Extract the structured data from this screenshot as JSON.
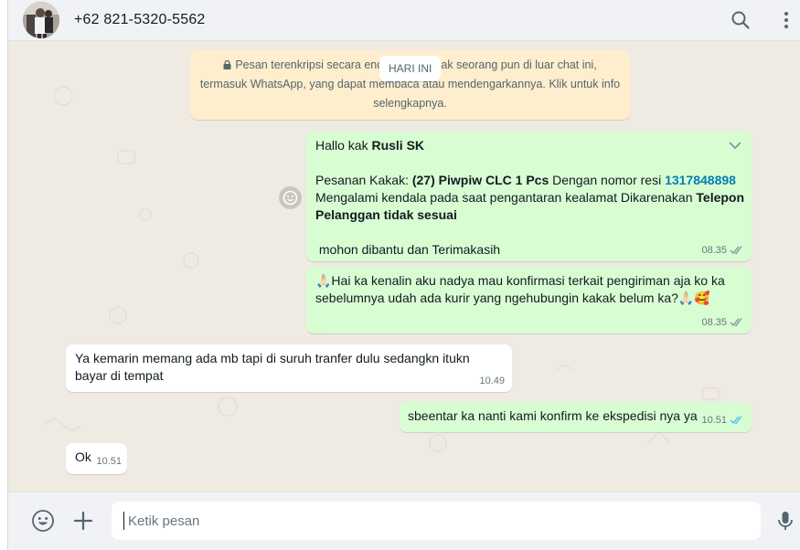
{
  "header": {
    "contact_name": "+62 821-5320-5562",
    "icons": [
      "search-icon",
      "menu-icon"
    ]
  },
  "encryption_notice": {
    "line1": "Pesan terenkripsi secara end-to-end. Tidak seorang pun di luar chat ini,",
    "line2": "termasuk WhatsApp, yang dapat membaca atau mendengarkannya. Klik untuk info",
    "line3": "selengkapnya."
  },
  "date_chip": "HARI INI",
  "messages": [
    {
      "direction": "out",
      "greeting": "Hallo kak ",
      "greeting_name": "Rusli SK",
      "order_prefix": "Pesanan Kakak: ",
      "order_item": "(27) Piwpiw CLC 1 Pcs",
      "order_mid": " Dengan nomor resi ",
      "resi": "1317848898",
      "issue_prefix": "Mengalami kendala pada saat pengantaran kealamat Dikarenakan ",
      "issue_reason": "Telepon Pelanggan tidak sesuai",
      "closing": " mohon dibantu dan Terimakasih",
      "time": "08.35",
      "status": "delivered"
    },
    {
      "direction": "out",
      "text": "🙏🏻Hai ka kenalin aku nadya mau konfirmasi terkait pengiriman aja ko ka sebelumnya udah ada kurir yang ngehubungin kakak belum ka?🙏🏻🥰",
      "time": "08.35",
      "status": "delivered"
    },
    {
      "direction": "in",
      "text": "Ya kemarin memang ada mb tapi di suruh tranfer dulu sedangkn itukn bayar di tempat",
      "time": "10.49"
    },
    {
      "direction": "out",
      "text": "sbeentar ka nanti kami konfirm ke ekspedisi nya ya",
      "time": "10.51",
      "status": "read"
    },
    {
      "direction": "in",
      "text": "Ok",
      "time": "10.51"
    }
  ],
  "composer": {
    "placeholder": "Ketik pesan",
    "icons": [
      "emoji-icon",
      "plus-icon",
      "microphone-icon"
    ]
  },
  "colors": {
    "outgoing_bubble": "#d9fdd3",
    "incoming_bubble": "#ffffff",
    "chat_background": "#efeae2",
    "encryption_notice": "#ffeecd",
    "link": "#027eb5",
    "read_ticks": "#53bdeb"
  }
}
